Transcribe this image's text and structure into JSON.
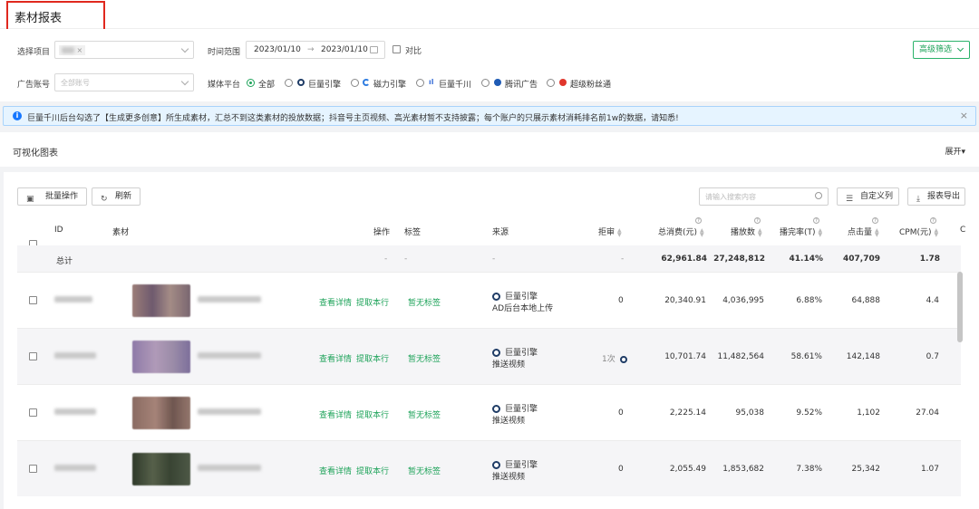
{
  "page": {
    "title": "素材报表"
  },
  "filters": {
    "project_label": "选择项目",
    "project_tag_close": "×",
    "date_label": "时间范围",
    "date_start": "2023/01/10",
    "date_arrow": "→",
    "date_end": "2023/01/10",
    "compare_label": "对比",
    "advanced_filter": "高级筛选",
    "account_label": "广告账号",
    "account_placeholder": "全部账号",
    "media_label": "媒体平台",
    "media_options": [
      "全部",
      "巨量引擎",
      "磁力引擎",
      "巨量千川",
      "腾讯广告",
      "超级粉丝通"
    ]
  },
  "notice": {
    "text": "巨量千川后台勾选了【生成更多创意】所生成素材，汇总不到这类素材的投放数据；抖音号主页视频、高光素材暂不支持披露；每个账户的只展示素材消耗排名前1w的数据，请知悉!",
    "close": "×"
  },
  "visual_section": {
    "title": "可视化图表",
    "expand": "展开▾"
  },
  "toolbar": {
    "batch": "批量操作",
    "refresh": "刷新",
    "search_placeholder": "请输入搜索内容",
    "custom_columns": "自定义列",
    "export": "报表导出"
  },
  "table": {
    "headers": {
      "id": "ID",
      "material": "素材",
      "action": "操作",
      "tag": "标签",
      "source": "来源",
      "review": "拒审",
      "cost": "总消费(元)",
      "plays": "播放数",
      "finish_rate": "播完率(T)",
      "clicks": "点击量",
      "cpm": "CPM(元)",
      "more": "C"
    },
    "total": {
      "label": "总计",
      "action": "-",
      "tag": "-",
      "source": "-",
      "review": "-",
      "cost": "62,961.84",
      "plays": "27,248,812",
      "finish_rate": "41.14%",
      "clicks": "407,709",
      "cpm": "1.78"
    },
    "rows": [
      {
        "view": "查看详情",
        "extract": "提取本行",
        "tag": "暂无标签",
        "source_platform": "巨量引擎",
        "source_detail": "AD后台本地上传",
        "review": "0",
        "cost": "20,340.91",
        "plays": "4,036,995",
        "finish_rate": "6.88%",
        "clicks": "64,888",
        "cpm": "4.4"
      },
      {
        "view": "查看详情",
        "extract": "提取本行",
        "tag": "暂无标签",
        "source_platform": "巨量引擎",
        "source_detail": "推送视频",
        "review": "1次",
        "cost": "10,701.74",
        "plays": "11,482,564",
        "finish_rate": "58.61%",
        "clicks": "142,148",
        "cpm": "0.7"
      },
      {
        "view": "查看详情",
        "extract": "提取本行",
        "tag": "暂无标签",
        "source_platform": "巨量引擎",
        "source_detail": "推送视频",
        "review": "0",
        "cost": "2,225.14",
        "plays": "95,038",
        "finish_rate": "9.52%",
        "clicks": "1,102",
        "cpm": "27.04"
      },
      {
        "view": "查看详情",
        "extract": "提取本行",
        "tag": "暂无标签",
        "source_platform": "巨量引擎",
        "source_detail": "推送视频",
        "review": "0",
        "cost": "2,055.49",
        "plays": "1,853,682",
        "finish_rate": "7.38%",
        "clicks": "25,342",
        "cpm": "1.07"
      }
    ]
  },
  "colors": {
    "accent_green": "#1ea35a",
    "notice_blue": "#1677ff",
    "highlight_red": "#e0281e"
  }
}
